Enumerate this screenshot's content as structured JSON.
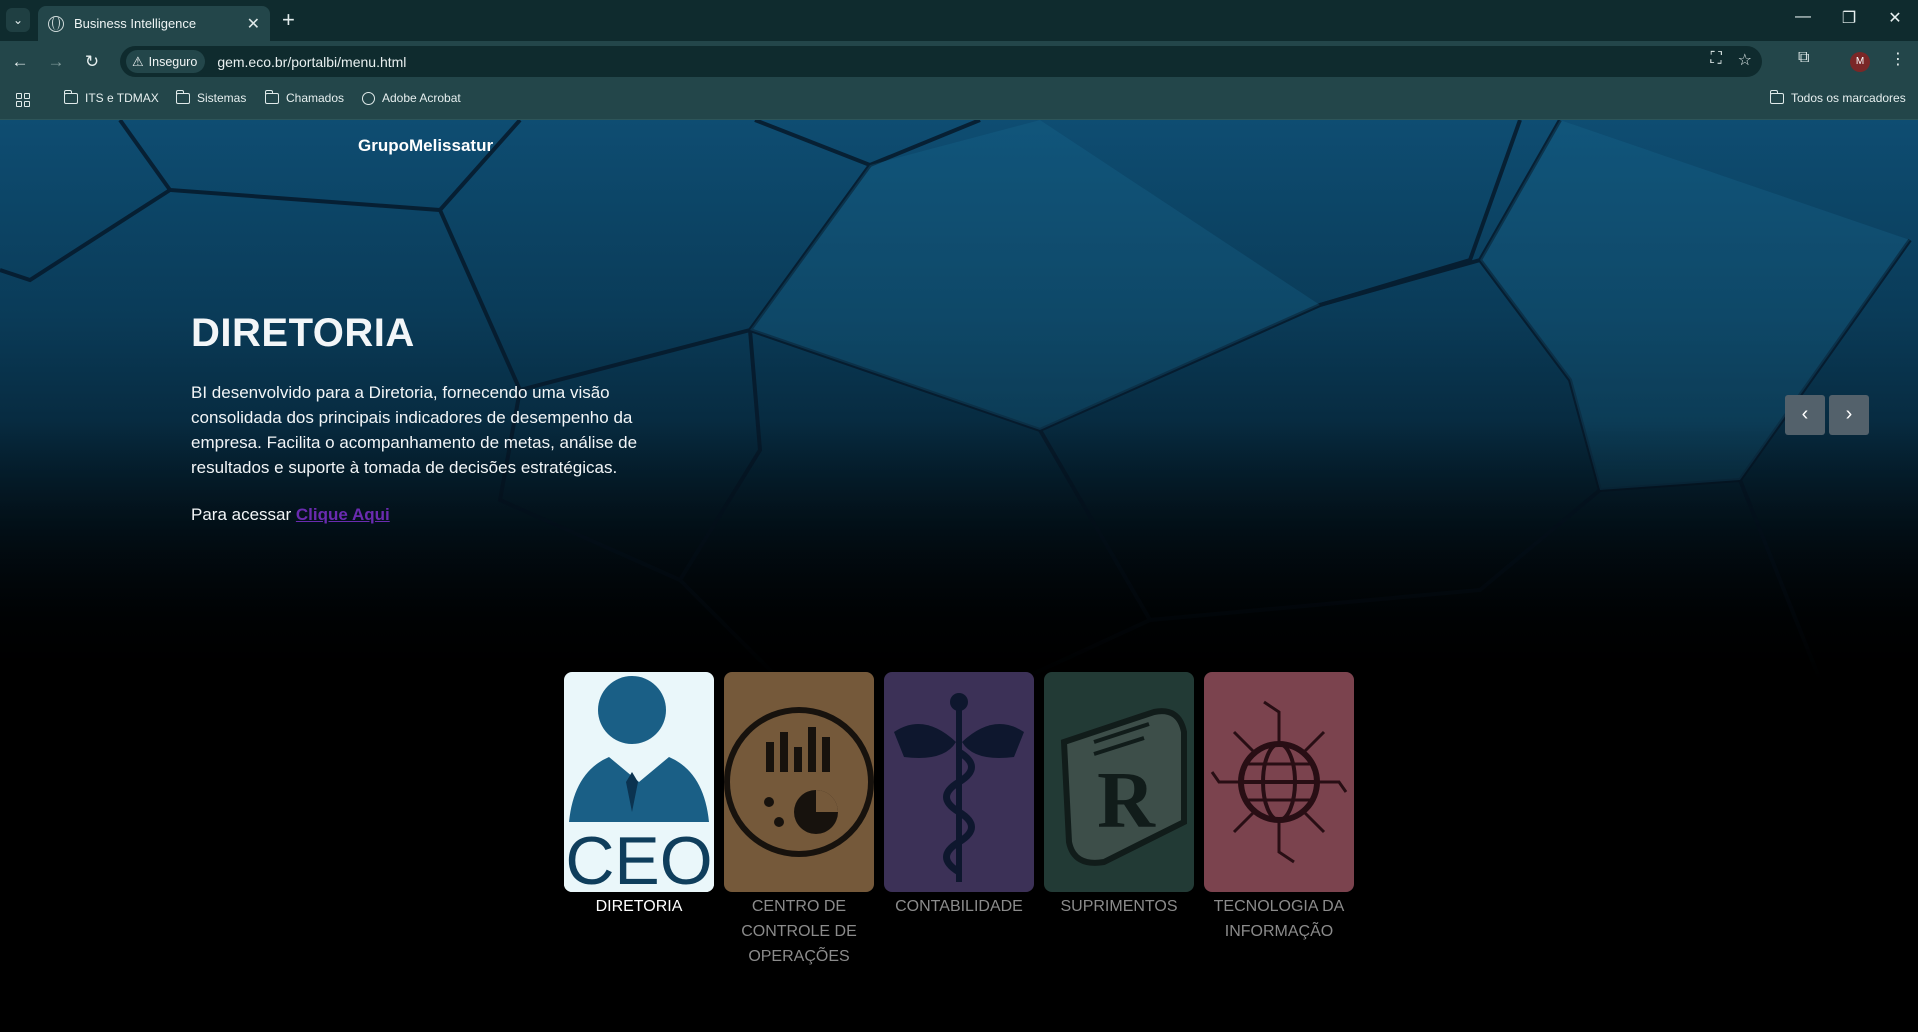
{
  "browser": {
    "tab_title": "Business Intelligence",
    "new_tab": "+",
    "security_label": "Inseguro",
    "url": "gem.eco.br/portalbi/menu.html",
    "profile_initial": "M",
    "bookmarks": [
      "ITS e TDMAX",
      "Sistemas",
      "Chamados",
      "Adobe Acrobat"
    ],
    "all_bookmarks": "Todos os marcadores"
  },
  "hero": {
    "brand": "GrupoMelissatur",
    "title": "DIRETORIA",
    "description": "BI desenvolvido para a Diretoria, fornecendo uma visão consolidada dos principais indicadores de desempenho da empresa. Facilita o acompanhamento de metas, análise de resultados e suporte à tomada de decisões estratégicas.",
    "access_prefix": "Para acessar",
    "access_link": "Clique Aqui",
    "prev": "‹",
    "next": "›"
  },
  "cards": [
    {
      "label": "DIRETORIA",
      "icon": "ceo-icon",
      "active": true,
      "bg": "#eaf7fa",
      "fg": "#1a5f86"
    },
    {
      "label": "CENTRO DE CONTROLE DE OPERAÇÕES",
      "icon": "operations-chart-icon",
      "active": false,
      "bg": "#d6a26a",
      "fg": "#2b2219"
    },
    {
      "label": "CONTABILIDADE",
      "icon": "caduceus-icon",
      "active": false,
      "bg": "#6d5a9e",
      "fg": "#1a2a55"
    },
    {
      "label": "SUPRIMENTOS",
      "icon": "document-r-icon",
      "active": false,
      "bg": "#3f6b62",
      "fg": "#1f3330"
    },
    {
      "label": "TECNOLOGIA DA INFORMAÇÃO",
      "icon": "circuit-globe-icon",
      "active": false,
      "bg": "#e07a8e",
      "fg": "#4a1a25"
    }
  ]
}
